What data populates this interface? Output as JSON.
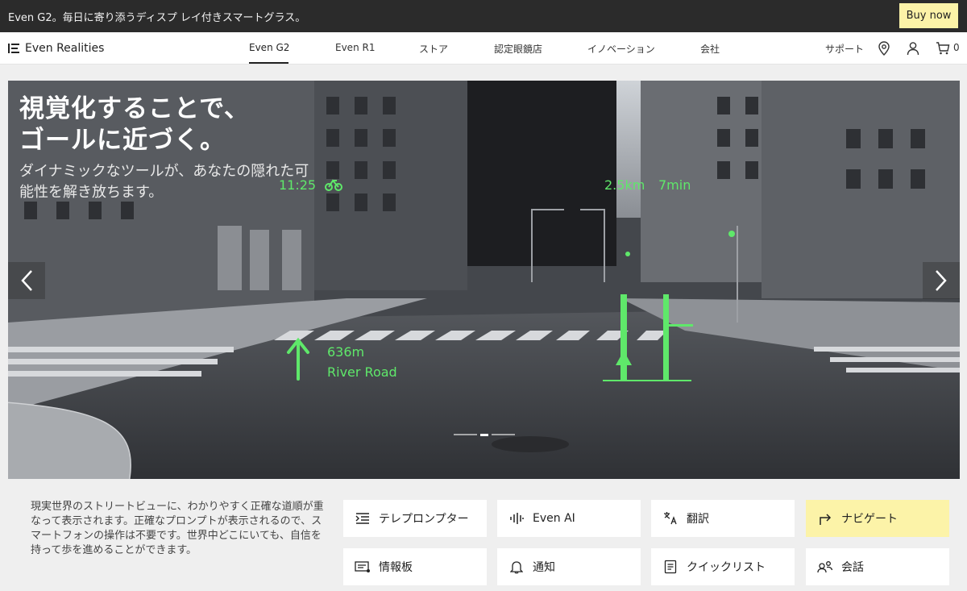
{
  "announcement": {
    "text": "Even G2。毎日に寄り添うディスプ レイ付きスマートグラス。",
    "buy_label": "Buy now"
  },
  "nav": {
    "brand": "Even Realities",
    "items": [
      {
        "label": "Even G2",
        "active": true
      },
      {
        "label": "Even R1"
      },
      {
        "label": "ストア"
      },
      {
        "label": "認定眼鏡店"
      },
      {
        "label": "イノベーション"
      },
      {
        "label": "会社"
      }
    ],
    "support_label": "サポート",
    "cart_count": "0",
    "icons": [
      "location-pin-icon",
      "user-icon",
      "cart-icon"
    ]
  },
  "hero": {
    "title": "視覚化することで、\nゴールに近づく。",
    "subtitle": "ダイナミックなツールが、あなたの隠れた可能性を解き放ちます。",
    "hud": {
      "time": "11:25",
      "distance_eta": "2.5km",
      "minutes": "7min",
      "turn_distance": "636m",
      "street": "River Road"
    },
    "slide_active_index": 1,
    "slide_count": 3
  },
  "features": {
    "description": "現実世界のストリートビューに、わかりやすく正確な道順が重なって表示されます。正確なプロンプトが表示されるので、スマートフォンの操作は不要です。世界中どこにいても、自信を持って歩を進めることができます。",
    "items": [
      {
        "label": "テレプロンプター",
        "icon": "teleprompter-icon"
      },
      {
        "label": "Even AI",
        "icon": "waveform-icon"
      },
      {
        "label": "翻訳",
        "icon": "translate-icon"
      },
      {
        "label": "ナビゲート",
        "icon": "turn-right-arrow-icon",
        "selected": true
      },
      {
        "label": "情報板",
        "icon": "dashboard-icon"
      },
      {
        "label": "通知",
        "icon": "bell-icon"
      },
      {
        "label": "クイックリスト",
        "icon": "list-icon"
      },
      {
        "label": "会話",
        "icon": "conversation-icon"
      }
    ]
  },
  "colors": {
    "accent": "#fcf3a8",
    "hud_green": "#5fe86a",
    "topbar": "#2b2b2b"
  }
}
